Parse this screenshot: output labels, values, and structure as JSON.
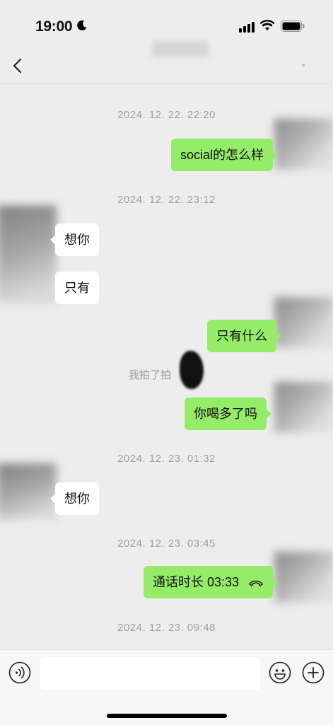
{
  "status_bar": {
    "time": "19:00"
  },
  "messages": [
    {
      "type": "timestamp",
      "text": "2024. 12. 22. 22:20"
    },
    {
      "type": "bubble",
      "side": "right",
      "text": "social的怎么样"
    },
    {
      "type": "timestamp",
      "text": "2024. 12. 22. 23:12"
    },
    {
      "type": "bubble",
      "side": "left",
      "text": "想你"
    },
    {
      "type": "bubble",
      "side": "left",
      "text": "只有"
    },
    {
      "type": "bubble",
      "side": "right",
      "text": "只有什么"
    },
    {
      "type": "system",
      "text": "我拍了拍"
    },
    {
      "type": "bubble",
      "side": "right",
      "text": "你喝多了吗"
    },
    {
      "type": "timestamp",
      "text": "2024. 12. 23. 01:32"
    },
    {
      "type": "bubble",
      "side": "left",
      "text": "想你"
    },
    {
      "type": "timestamp",
      "text": "2024. 12. 23. 03:45"
    },
    {
      "type": "bubble",
      "side": "right",
      "text": "通话时长 03:33",
      "icon": "phone-icon"
    },
    {
      "type": "timestamp",
      "text": "2024. 12. 23. 09:48"
    }
  ],
  "input_bar": {
    "value": ""
  },
  "colors": {
    "bubble_right": "#95ec69",
    "bubble_left": "#ffffff",
    "background": "#ededed"
  }
}
